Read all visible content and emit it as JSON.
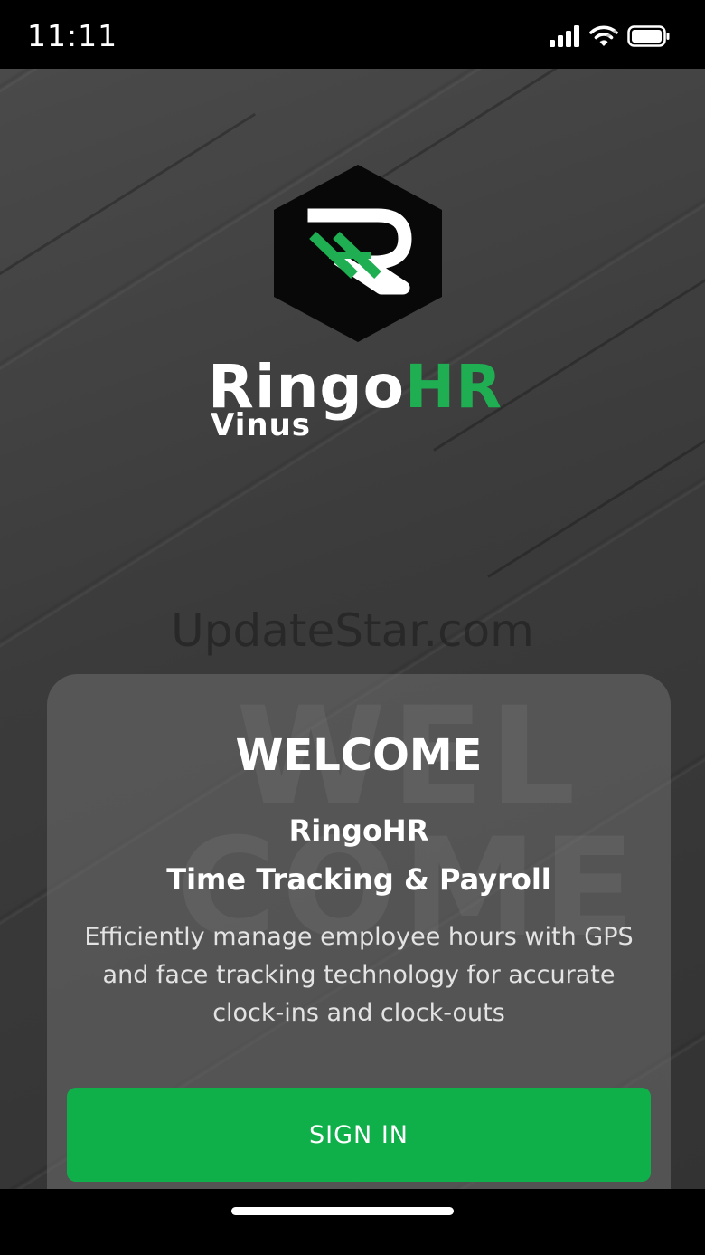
{
  "status_bar": {
    "time": "11:11",
    "icons": [
      "signal-icon",
      "wifi-icon",
      "battery-icon"
    ]
  },
  "brand": {
    "name_part1": "Ringo",
    "name_part2": "HR",
    "sublabel": "Vinus",
    "accent_color": "#1faf52"
  },
  "watermark": "UpdateStar.com",
  "welcome_card": {
    "background_text": "WELCOME",
    "title": "WELCOME",
    "subtitle_line1": "RingoHR",
    "subtitle_line2": "Time Tracking & Payroll",
    "description": "Efficiently manage employee hours with GPS and face tracking technology for accurate clock-ins and clock-outs",
    "sign_in_label": "SIGN IN",
    "button_color": "#0fb04a"
  }
}
